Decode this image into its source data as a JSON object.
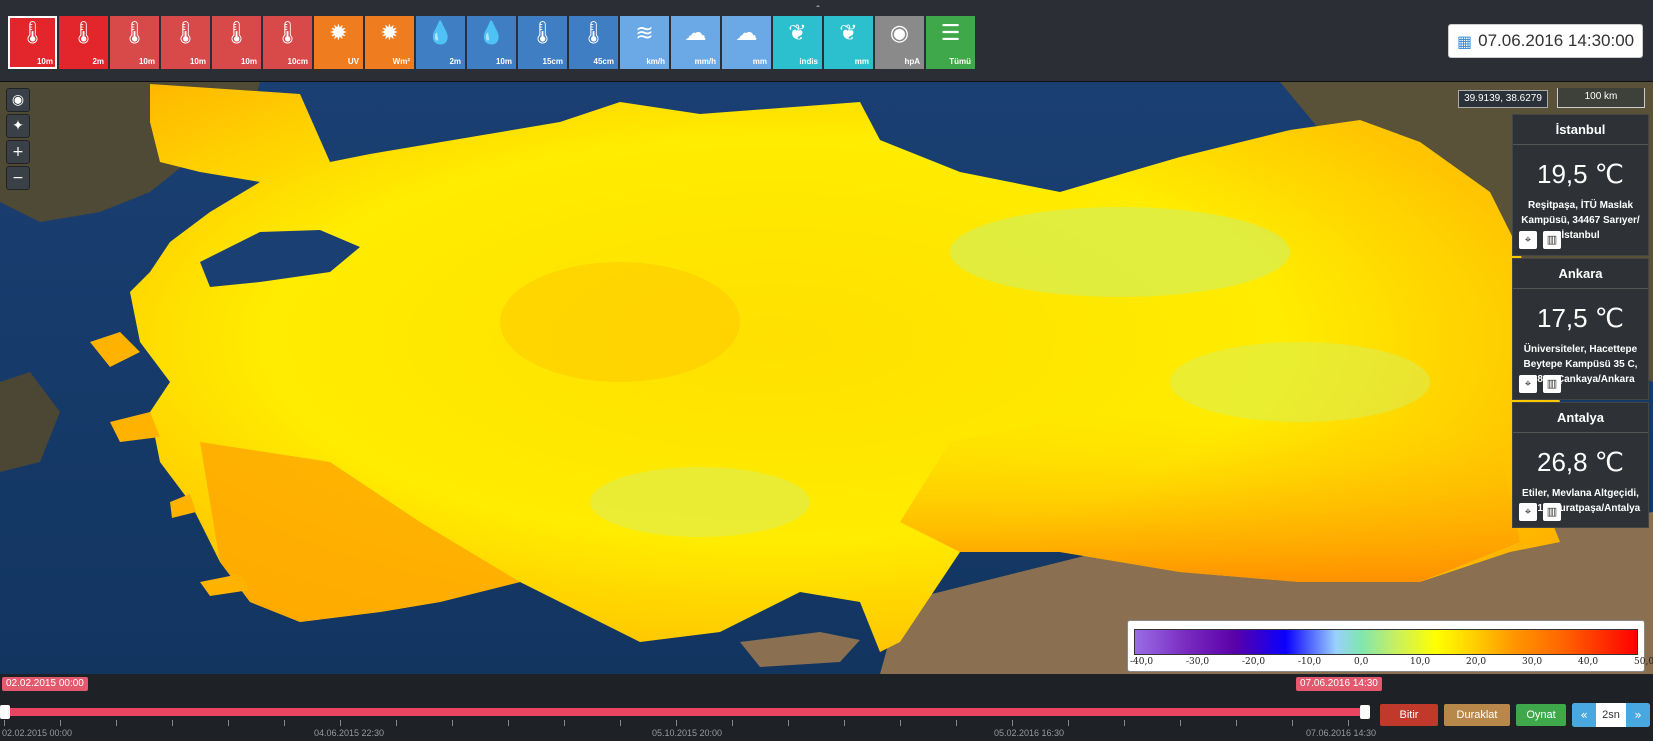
{
  "toolbar": {
    "collapse_glyph": "ˆ",
    "buttons": [
      {
        "icon": "thermometer-snow-icon",
        "glyph": "🌡",
        "label": "10m",
        "color": "#e2262b"
      },
      {
        "icon": "thermometer-snow-icon",
        "glyph": "🌡",
        "label": "2m",
        "color": "#e2262b"
      },
      {
        "icon": "thermometer-icon",
        "glyph": "🌡",
        "label": "10m",
        "color": "#d84a4a"
      },
      {
        "icon": "thermometer-icon",
        "glyph": "🌡",
        "label": "10m",
        "color": "#d84a4a"
      },
      {
        "icon": "thermometer-icon",
        "glyph": "🌡",
        "label": "10m",
        "color": "#d84a4a"
      },
      {
        "icon": "thermometer-icon",
        "glyph": "🌡",
        "label": "10cm",
        "color": "#d84a4a"
      },
      {
        "icon": "uv-sun-icon",
        "glyph": "✹",
        "label": "UV",
        "color": "#ef7d1f"
      },
      {
        "icon": "solar-radiation-icon",
        "glyph": "✹",
        "label": "Wm²",
        "color": "#ef7d1f"
      },
      {
        "icon": "humidity-drop-icon",
        "glyph": "💧",
        "label": "2m",
        "color": "#3f7ec3"
      },
      {
        "icon": "humidity-drop-icon",
        "glyph": "💧",
        "label": "10m",
        "color": "#3f7ec3"
      },
      {
        "icon": "soil-thermometer-icon",
        "glyph": "🌡",
        "label": "15cm",
        "color": "#3f7ec3"
      },
      {
        "icon": "soil-thermometer-icon",
        "glyph": "🌡",
        "label": "45cm",
        "color": "#3f7ec3"
      },
      {
        "icon": "wind-icon",
        "glyph": "≋",
        "label": "km/h",
        "color": "#6aa9e6"
      },
      {
        "icon": "rain-cloud-icon",
        "glyph": "☁",
        "label": "mm/h",
        "color": "#6aa9e6"
      },
      {
        "icon": "rain-cloud-icon",
        "glyph": "☁",
        "label": "mm",
        "color": "#6aa9e6"
      },
      {
        "icon": "leaf-icon",
        "glyph": "❦",
        "label": "indis",
        "color": "#2cc0cf"
      },
      {
        "icon": "plant-icon",
        "glyph": "❦",
        "label": "mm",
        "color": "#2cc0cf"
      },
      {
        "icon": "pressure-gauge-icon",
        "glyph": "◉",
        "label": "hpA",
        "color": "#8a8a8a"
      },
      {
        "icon": "download-list-icon",
        "glyph": "☰",
        "label": "Tümü",
        "color": "#3fa84a"
      }
    ]
  },
  "datetime": {
    "value": "07.06.2016 14:30:00",
    "icon": "calendar-icon"
  },
  "map": {
    "controls": [
      {
        "name": "globe-icon",
        "glyph": "◉"
      },
      {
        "name": "locate-icon",
        "glyph": "✦"
      },
      {
        "name": "zoom-in-icon",
        "glyph": "+"
      },
      {
        "name": "zoom-out-icon",
        "glyph": "−"
      }
    ],
    "coords": "39.9139, 38.6279",
    "scale": "100 km",
    "cities": [
      {
        "name": "İstanbul",
        "temp": "19,5 ℃",
        "address": "Reşitpaşa, İTÜ Maslak Kampüsü, 34467 Sarıyer/ İstanbul"
      },
      {
        "name": "Ankara",
        "temp": "17,5 ℃",
        "address": "Üniversiteler, Hacettepe Beytepe Kampüsü 35 C, 06800 Çankaya/Ankara"
      },
      {
        "name": "Antalya",
        "temp": "26,8 ℃",
        "address": "Etiler, Mevlana Altgeçidi, 07010 Muratpaşa/Antalya"
      }
    ],
    "legend_ticks": [
      "-40,0",
      "-30,0",
      "-20,0",
      "-10,0",
      "0,0",
      "10,0",
      "20,0",
      "30,0",
      "40,0",
      "50,0"
    ]
  },
  "timeline": {
    "start_flag": "02.02.2015 00:00",
    "end_flag": "07.06.2016 14:30",
    "tick_labels": [
      "02.02.2015 00:00",
      "04.06.2015 22:30",
      "05.10.2015 20:00",
      "05.02.2016 16:30",
      "07.06.2016 14:30"
    ],
    "buttons": {
      "stop": "Bitir",
      "pause": "Duraklat",
      "play": "Oynat"
    },
    "speed": "2sn"
  }
}
